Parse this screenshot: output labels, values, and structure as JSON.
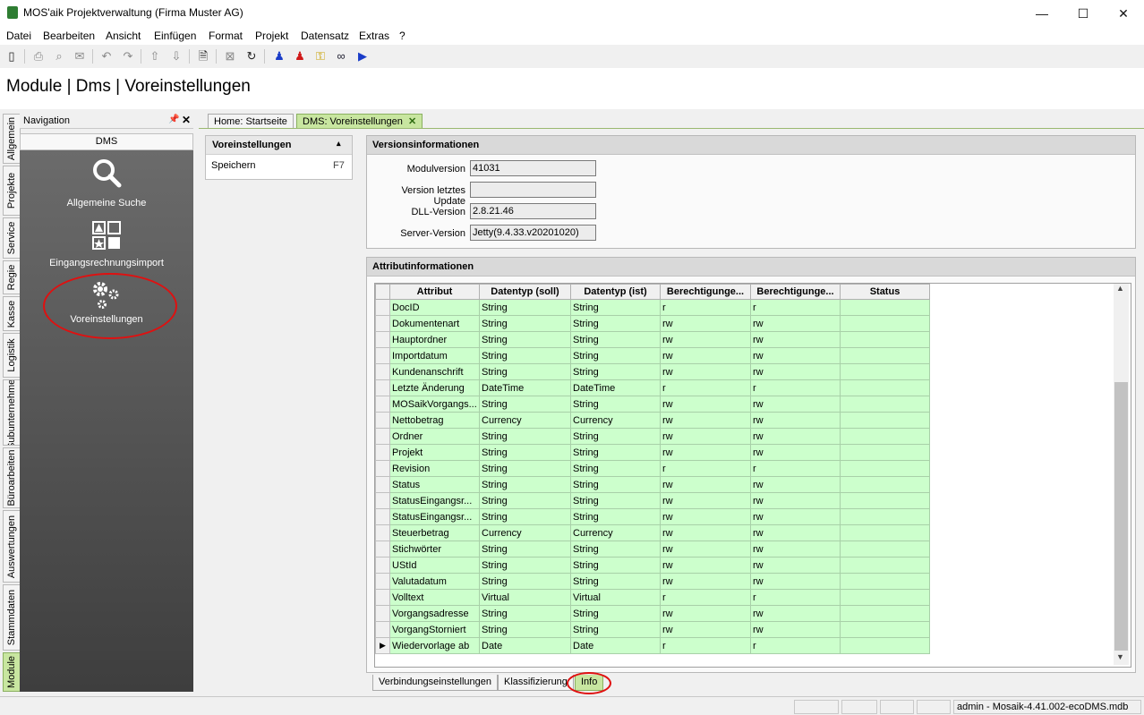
{
  "window": {
    "title": "MOS'aik Projektverwaltung (Firma Muster AG)",
    "min": "—",
    "max": "☐",
    "close": "✕"
  },
  "menu": [
    "Datei",
    "Bearbeiten",
    "Ansicht",
    "Einfügen",
    "Format",
    "Projekt",
    "Datensatz",
    "Extras",
    "?"
  ],
  "toolbar": {
    "icons": [
      "new-doc-icon",
      "print-icon",
      "print-preview-icon",
      "mail-icon",
      "undo-icon",
      "redo-icon",
      "up-arrow-icon",
      "down-arrow-icon",
      "search-doc-icon",
      "delete-icon",
      "refresh-icon",
      "user-blue-icon",
      "user-red-icon",
      "keys-icon",
      "binoculars-icon",
      "play-icon"
    ]
  },
  "page_title": "Module | Dms | Voreinstellungen",
  "vertical_tabs": [
    "Allgemein",
    "Projekte",
    "Service",
    "Regie",
    "Kasse",
    "Logistik",
    "Subunternehmer",
    "Büroarbeiten",
    "Auswertungen",
    "Stammdaten",
    "Module"
  ],
  "navigation": {
    "title": "Navigation",
    "pin": "📌",
    "close": "✕",
    "section": "DMS",
    "items": [
      {
        "label": "Allgemeine Suche",
        "icon": "search-icon"
      },
      {
        "label": "Eingangsrechnungsimport",
        "icon": "shapes-icon"
      },
      {
        "label": "Voreinstellungen",
        "icon": "gears-icon"
      }
    ]
  },
  "doc_tabs": [
    {
      "label": "Home: Startseite"
    },
    {
      "label": "DMS: Voreinstellungen",
      "close": "✕"
    }
  ],
  "taskpane": {
    "title": "Voreinstellungen",
    "collapse": "▴",
    "item": "Speichern",
    "shortcut": "F7"
  },
  "version_info": {
    "title": "Versionsinformationen",
    "fields": [
      {
        "label": "Modulversion",
        "value": "41031"
      },
      {
        "label": "Version letztes Update",
        "value": ""
      },
      {
        "label": "DLL-Version",
        "value": "2.8.21.46"
      },
      {
        "label": "Server-Version",
        "value": "Jetty(9.4.33.v20201020)"
      }
    ]
  },
  "attribute_info": {
    "title": "Attributinformationen",
    "columns": [
      "Attribut",
      "Datentyp (soll)",
      "Datentyp (ist)",
      "Berechtigunge...",
      "Berechtigunge...",
      "Status"
    ],
    "rows": [
      [
        "DocID",
        "String",
        "String",
        "r",
        "r",
        ""
      ],
      [
        "Dokumentenart",
        "String",
        "String",
        "rw",
        "rw",
        ""
      ],
      [
        "Hauptordner",
        "String",
        "String",
        "rw",
        "rw",
        ""
      ],
      [
        "Importdatum",
        "String",
        "String",
        "rw",
        "rw",
        ""
      ],
      [
        "Kundenanschrift",
        "String",
        "String",
        "rw",
        "rw",
        ""
      ],
      [
        "Letzte Änderung",
        "DateTime",
        "DateTime",
        "r",
        "r",
        ""
      ],
      [
        "MOSaikVorgangs...",
        "String",
        "String",
        "rw",
        "rw",
        ""
      ],
      [
        "Nettobetrag",
        "Currency",
        "Currency",
        "rw",
        "rw",
        ""
      ],
      [
        "Ordner",
        "String",
        "String",
        "rw",
        "rw",
        ""
      ],
      [
        "Projekt",
        "String",
        "String",
        "rw",
        "rw",
        ""
      ],
      [
        "Revision",
        "String",
        "String",
        "r",
        "r",
        ""
      ],
      [
        "Status",
        "String",
        "String",
        "rw",
        "rw",
        ""
      ],
      [
        "StatusEingangsr...",
        "String",
        "String",
        "rw",
        "rw",
        ""
      ],
      [
        "StatusEingangsr...",
        "String",
        "String",
        "rw",
        "rw",
        ""
      ],
      [
        "Steuerbetrag",
        "Currency",
        "Currency",
        "rw",
        "rw",
        ""
      ],
      [
        "Stichwörter",
        "String",
        "String",
        "rw",
        "rw",
        ""
      ],
      [
        "UStId",
        "String",
        "String",
        "rw",
        "rw",
        ""
      ],
      [
        "Valutadatum",
        "String",
        "String",
        "rw",
        "rw",
        ""
      ],
      [
        "Volltext",
        "Virtual",
        "Virtual",
        "r",
        "r",
        ""
      ],
      [
        "Vorgangsadresse",
        "String",
        "String",
        "rw",
        "rw",
        ""
      ],
      [
        "VorgangStorniert",
        "String",
        "String",
        "rw",
        "rw",
        ""
      ],
      [
        "Wiedervorlage ab",
        "Date",
        "Date",
        "r",
        "r",
        ""
      ]
    ],
    "current_row_marker": "▶",
    "current_row_index": 21
  },
  "bottom_tabs": [
    "Verbindungseinstellungen",
    "Klassifizierung",
    "Info"
  ],
  "active_bottom_tab": "Info",
  "status_bar": {
    "text": "admin - Mosaik-4.41.002-ecoDMS.mdb"
  },
  "scroll": {
    "up": "▲",
    "down": "▼"
  }
}
